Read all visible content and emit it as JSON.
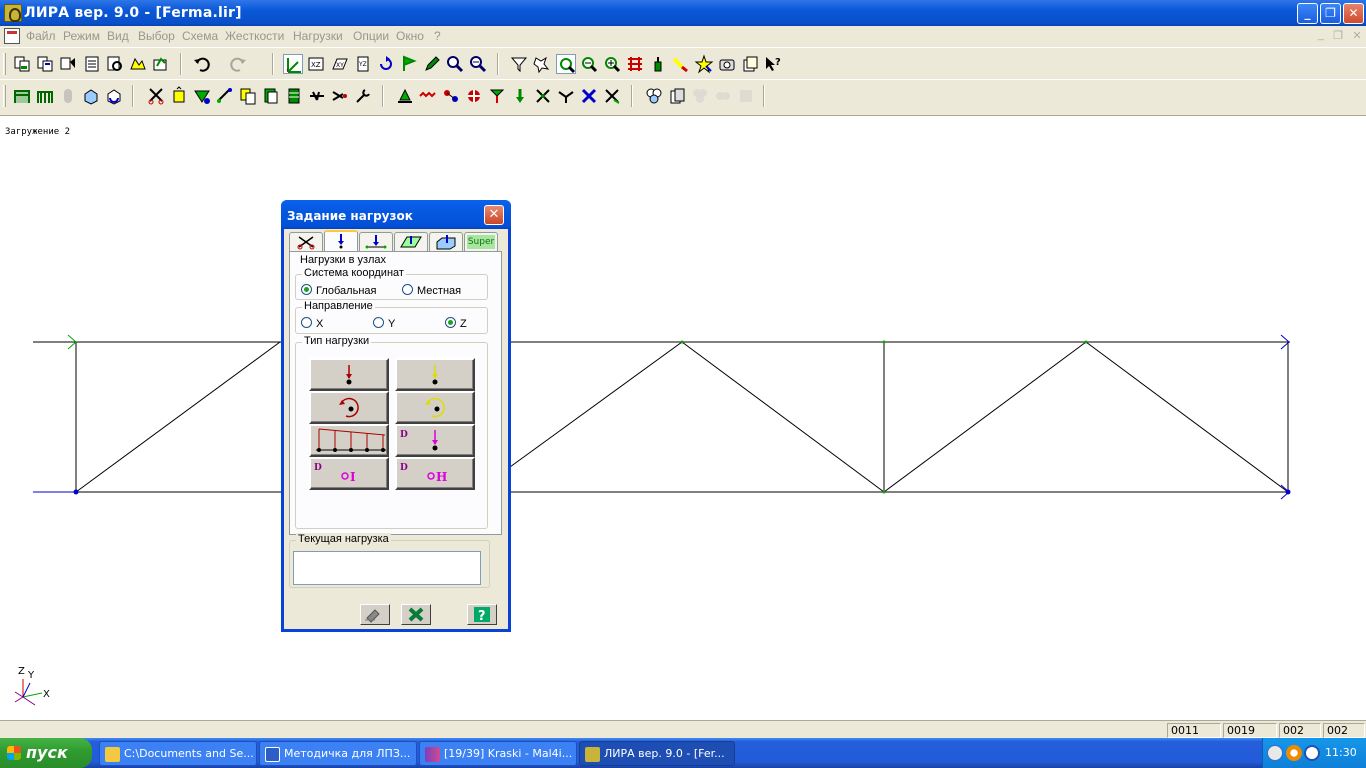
{
  "window": {
    "title": "ЛИРА  вер. 9.0 - [Ferma.lir]",
    "controls": {
      "minimize": "_",
      "maximize": "❐",
      "close": "✕"
    }
  },
  "menu": {
    "items": [
      "Файл",
      "Режим",
      "Вид",
      "Выбор",
      "Схема",
      "Жесткости",
      "Нагрузки",
      "Опции",
      "Окно",
      "?"
    ],
    "mdi_controls": {
      "minimize": "_",
      "restore": "❐",
      "close": "✕"
    }
  },
  "workspace": {
    "load_case_label": "Загружение 2",
    "axes": {
      "z": "Z",
      "y": "Y",
      "x": "X"
    },
    "colors": {
      "truss_line": "#000000",
      "axis_line": "#0000cc",
      "node": "#00a000"
    }
  },
  "dialog": {
    "title": "Задание нагрузок",
    "close": "✕",
    "tabs": [
      {
        "icon": "delete-load-icon"
      },
      {
        "icon": "nodal-load-icon",
        "active": true
      },
      {
        "icon": "bar-load-icon"
      },
      {
        "icon": "plate-load-icon"
      },
      {
        "icon": "solid-load-icon"
      },
      {
        "label": "Super"
      }
    ],
    "panel_title": "Нагрузки в узлах",
    "coord_system": {
      "label": "Система координат",
      "options": [
        "Глобальная",
        "Местная"
      ],
      "selected": "Глобальная"
    },
    "direction": {
      "label": "Направление",
      "options": [
        "X",
        "Y",
        "Z"
      ],
      "selected": "Z"
    },
    "load_type": {
      "label": "Тип нагрузки",
      "buttons": [
        {
          "name": "concentrated-force",
          "icon": "force-arrow-red-icon"
        },
        {
          "name": "concentrated-force-alt",
          "icon": "force-arrow-yellow-icon"
        },
        {
          "name": "moment",
          "icon": "moment-red-icon"
        },
        {
          "name": "moment-alt",
          "icon": "moment-yellow-icon"
        },
        {
          "name": "distributed-trapezoid",
          "icon": "trapezoid-load-icon"
        },
        {
          "name": "dynamic-force",
          "icon": "dynamic-force-icon",
          "label": "D"
        },
        {
          "name": "dynamic-impulse",
          "icon": "dynamic-impulse-icon",
          "label": "D",
          "sub": "I"
        },
        {
          "name": "dynamic-harmonic",
          "icon": "dynamic-harmonic-icon",
          "label": "D",
          "sub": "H"
        }
      ]
    },
    "current_load": {
      "label": "Текущая нагрузка",
      "value": ""
    },
    "buttons": {
      "apply": "apply-icon",
      "cancel": "cancel-icon",
      "help": "help-icon"
    }
  },
  "statusbar": {
    "cells": [
      "0011",
      "0019",
      "002",
      "002"
    ]
  },
  "taskbar": {
    "start": "пуск",
    "tasks": [
      {
        "label": "C:\\Documents and Se...",
        "icon": "folder-icon"
      },
      {
        "label": "Методичка для ЛПЗ...",
        "icon": "word-icon"
      },
      {
        "label": "[19/39] Kraski - Mal4i...",
        "icon": "messenger-icon"
      },
      {
        "label": "ЛИРА  вер. 9.0 - [Fer...",
        "icon": "lira-icon",
        "active": true
      }
    ],
    "clock": "11:30"
  }
}
